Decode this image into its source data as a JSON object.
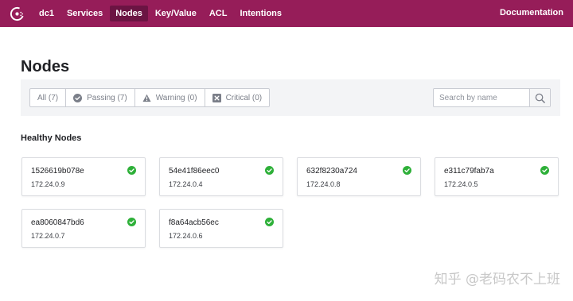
{
  "nav": {
    "datacenter": "dc1",
    "items": [
      {
        "label": "Services"
      },
      {
        "label": "Nodes"
      },
      {
        "label": "Key/Value"
      },
      {
        "label": "ACL"
      },
      {
        "label": "Intentions"
      }
    ],
    "documentation": "Documentation",
    "brand_color": "#961d59",
    "active_color": "#6b1443"
  },
  "page": {
    "title": "Nodes"
  },
  "filters": [
    {
      "label": "All (7)",
      "icon": ""
    },
    {
      "label": "Passing (7)",
      "icon": "check-circle-icon"
    },
    {
      "label": "Warning (0)",
      "icon": "warning-triangle-icon"
    },
    {
      "label": "Critical (0)",
      "icon": "x-square-icon"
    }
  ],
  "search": {
    "placeholder": "Search by name",
    "value": ""
  },
  "section": {
    "title": "Healthy Nodes"
  },
  "nodes": [
    {
      "name": "1526619b078e",
      "address": "172.24.0.9"
    },
    {
      "name": "54e41f86eec0",
      "address": "172.24.0.4"
    },
    {
      "name": "632f8230a724",
      "address": "172.24.0.8"
    },
    {
      "name": "e311c79fab7a",
      "address": "172.24.0.5"
    },
    {
      "name": "ea8060847bd6",
      "address": "172.24.0.7"
    },
    {
      "name": "f8a64acb56ec",
      "address": "172.24.0.6"
    }
  ],
  "status_color": "#2eb039",
  "watermark": "知乎 @老码农不上班"
}
